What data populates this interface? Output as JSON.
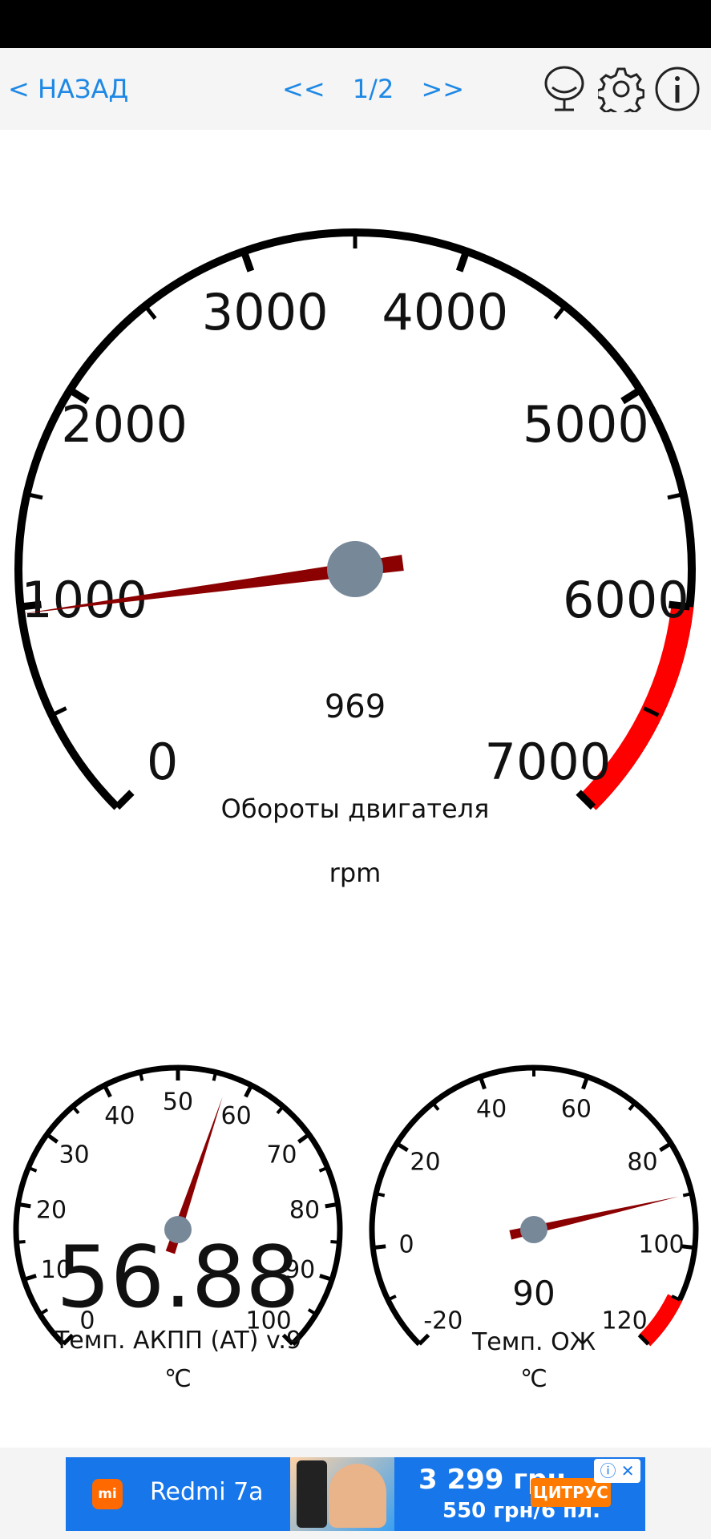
{
  "header": {
    "back_label": "< НАЗАД",
    "prev_label": "<<",
    "page_indicator": "1/2",
    "next_label": ">>",
    "icons": [
      "microphone-icon",
      "gear-icon",
      "info-icon"
    ]
  },
  "gauges": [
    {
      "title": "Обороты двигателя",
      "unit": "rpm",
      "value": 969,
      "value_label": "969",
      "min": 0,
      "max": 7000,
      "tick_labels": [
        "0",
        "1000",
        "2000",
        "3000",
        "4000",
        "5000",
        "6000",
        "7000"
      ],
      "redline_from": 6000
    },
    {
      "title": "Темп. АКПП (AT) v.9",
      "unit": "℃",
      "value": 56.88,
      "value_label": "56.88",
      "min": 0,
      "max": 100,
      "tick_labels": [
        "0",
        "10",
        "20",
        "30",
        "40",
        "50",
        "60",
        "70",
        "80",
        "90",
        "100"
      ]
    },
    {
      "title": "Темп. ОЖ",
      "unit": "℃",
      "value": 90,
      "value_label": "90",
      "min": -20,
      "max": 120,
      "tick_labels": [
        "-20",
        "0",
        "20",
        "40",
        "60",
        "80",
        "100",
        "120"
      ],
      "redline_from": 110
    }
  ],
  "ad": {
    "logo_text": "mi",
    "product": "Redmi 7a",
    "price": "3 299 грн",
    "price_alt": "550 грн/6 пл.",
    "brand": "ЦИТРУС",
    "info_close": "ⓘ ✕"
  },
  "colors": {
    "accent": "#1e88e5",
    "needle": "#8b0000",
    "redzone": "#ff0000",
    "hub": "#778899"
  }
}
